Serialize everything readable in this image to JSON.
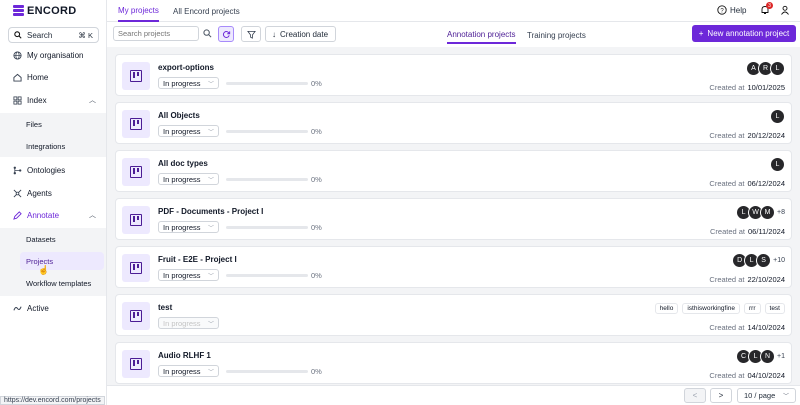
{
  "brand": {
    "name": "ENCORD",
    "accent": "#6d28d9"
  },
  "sidebar": {
    "search_label": "Search",
    "search_shortcut": "⌘ K",
    "items": [
      {
        "label": "My organisation",
        "icon": "globe-icon"
      },
      {
        "label": "Home",
        "icon": "home-icon"
      },
      {
        "label": "Index",
        "icon": "grid-icon",
        "expanded": true
      },
      {
        "label": "Ontologies",
        "icon": "ontology-icon"
      },
      {
        "label": "Agents",
        "icon": "agents-icon"
      },
      {
        "label": "Annotate",
        "icon": "annotate-icon",
        "expanded": true
      },
      {
        "label": "Active",
        "icon": "active-icon"
      }
    ],
    "index_sub": [
      "Files",
      "Integrations"
    ],
    "annotate_sub": [
      "Datasets",
      "Projects",
      "Workflow templates"
    ],
    "status_url": "https://dev.encord.com/projects"
  },
  "header": {
    "tabs": [
      "My projects",
      "All Encord projects"
    ],
    "help_label": "Help",
    "notifications_count": "3"
  },
  "toolbar": {
    "search_placeholder": "Search projects",
    "sort_label": "Creation date",
    "sub_tabs": [
      "Annotation projects",
      "Training projects"
    ],
    "new_button": "New annotation project"
  },
  "projects": [
    {
      "title": "export-options",
      "status": "In progress",
      "progress": "0%",
      "created_label": "Created at",
      "created": "10/01/2025",
      "avatars": [
        "A",
        "R",
        "L"
      ],
      "more": ""
    },
    {
      "title": "All Objects",
      "status": "In progress",
      "progress": "0%",
      "created_label": "Created at",
      "created": "20/12/2024",
      "avatars": [
        "L"
      ],
      "more": ""
    },
    {
      "title": "All doc types",
      "status": "In progress",
      "progress": "0%",
      "created_label": "Created at",
      "created": "06/12/2024",
      "avatars": [
        "L"
      ],
      "more": ""
    },
    {
      "title": "PDF - Documents - Project I",
      "status": "In progress",
      "progress": "0%",
      "created_label": "Created at",
      "created": "06/11/2024",
      "avatars": [
        "L",
        "W",
        "M"
      ],
      "more": "+8"
    },
    {
      "title": "Fruit - E2E - Project I",
      "status": "In progress",
      "progress": "0%",
      "created_label": "Created at",
      "created": "22/10/2024",
      "avatars": [
        "D",
        "L",
        "S"
      ],
      "more": "+10"
    },
    {
      "title": "test",
      "status": "In progress",
      "progress": "",
      "created_label": "Created at",
      "created": "14/10/2024",
      "tags": [
        "hello",
        "isthisworkingfine",
        "rrr",
        "test"
      ],
      "disabled": true
    },
    {
      "title": "Audio RLHF 1",
      "status": "In progress",
      "progress": "0%",
      "created_label": "Created at",
      "created": "04/10/2024",
      "avatars": [
        "C",
        "L",
        "N"
      ],
      "more": "+1"
    }
  ],
  "pagination": {
    "prev": "<",
    "next": ">",
    "page_size": "10 / page"
  }
}
